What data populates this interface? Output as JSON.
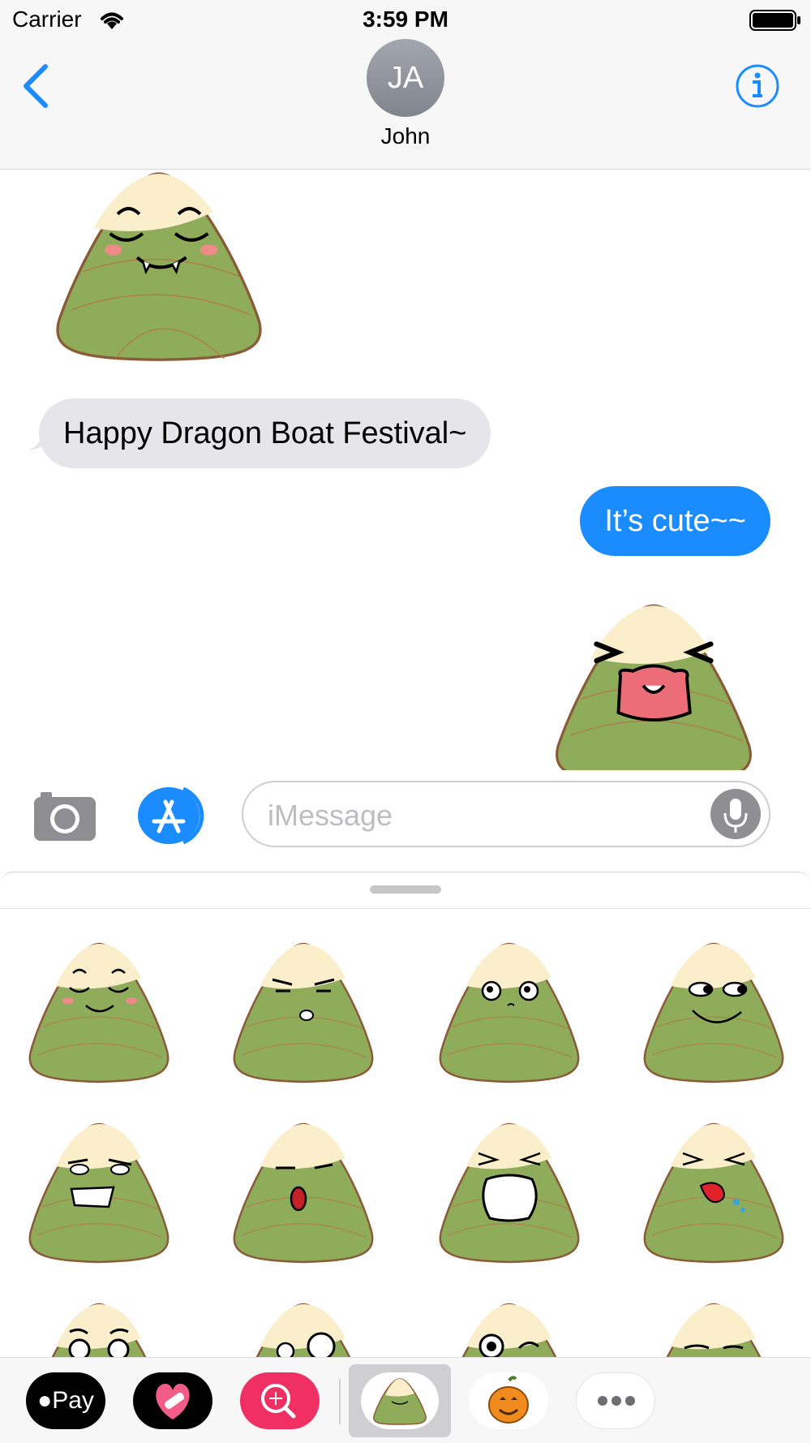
{
  "status_bar": {
    "carrier": "Carrier",
    "time": "3:59 PM"
  },
  "header": {
    "back_icon": "chevron-left-icon",
    "avatar_initials": "JA",
    "contact_name": "John",
    "info_icon": "info-icon"
  },
  "conversation": {
    "incoming_text": "Happy Dragon Boat Festival~",
    "outgoing_text": "It’s cute~~"
  },
  "input_bar": {
    "placeholder": "iMessage",
    "camera_icon": "camera-icon",
    "appstore_icon": "app-store-icon",
    "mic_icon": "microphone-icon"
  },
  "tray": {
    "apple_pay_label": "Pay",
    "apps": [
      "apple-pay",
      "heart-bandage-app",
      "image-search-app",
      "zongzi-stickers-app",
      "pumpkin-app",
      "more-apps"
    ]
  },
  "colors": {
    "accent": "#1a8cff",
    "incoming_bubble": "#e5e5ea",
    "zongzi_leaf": "#8fac5b",
    "zongzi_rice": "#fbeecb",
    "zongzi_outline": "#8a5b37"
  }
}
